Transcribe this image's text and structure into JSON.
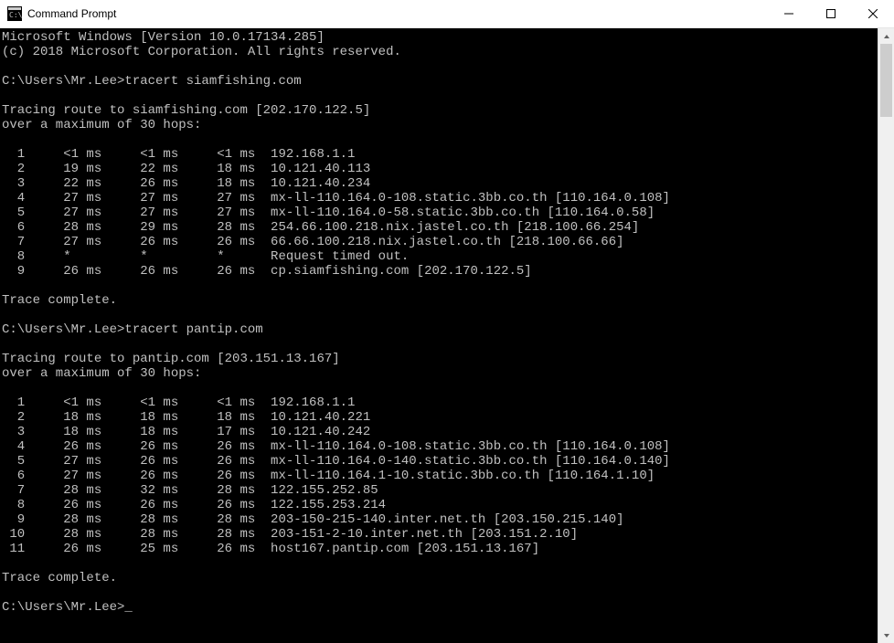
{
  "window": {
    "title": "Command Prompt",
    "minimize_glyph": "─",
    "maximize_glyph": "☐",
    "close_glyph": "✕"
  },
  "os_banner": {
    "line1": "Microsoft Windows [Version 10.0.17134.285]",
    "line2": "(c) 2018 Microsoft Corporation. All rights reserved."
  },
  "prompt_path": "C:\\Users\\Mr.Lee>",
  "commands": [
    {
      "cmd": "tracert siamfishing.com",
      "tracing_line": "Tracing route to siamfishing.com [202.170.122.5]",
      "max_hops_line": "over a maximum of 30 hops:",
      "hops": [
        {
          "n": "1",
          "t1": "<1 ms",
          "t2": "<1 ms",
          "t3": "<1 ms",
          "dest": "192.168.1.1"
        },
        {
          "n": "2",
          "t1": "19 ms",
          "t2": "22 ms",
          "t3": "18 ms",
          "dest": "10.121.40.113"
        },
        {
          "n": "3",
          "t1": "22 ms",
          "t2": "26 ms",
          "t3": "18 ms",
          "dest": "10.121.40.234"
        },
        {
          "n": "4",
          "t1": "27 ms",
          "t2": "27 ms",
          "t3": "27 ms",
          "dest": "mx-ll-110.164.0-108.static.3bb.co.th [110.164.0.108]"
        },
        {
          "n": "5",
          "t1": "27 ms",
          "t2": "27 ms",
          "t3": "27 ms",
          "dest": "mx-ll-110.164.0-58.static.3bb.co.th [110.164.0.58]"
        },
        {
          "n": "6",
          "t1": "28 ms",
          "t2": "29 ms",
          "t3": "28 ms",
          "dest": "254.66.100.218.nix.jastel.co.th [218.100.66.254]"
        },
        {
          "n": "7",
          "t1": "27 ms",
          "t2": "26 ms",
          "t3": "26 ms",
          "dest": "66.66.100.218.nix.jastel.co.th [218.100.66.66]"
        },
        {
          "n": "8",
          "t1": "*",
          "t2": "*",
          "t3": "*",
          "dest": "Request timed out."
        },
        {
          "n": "9",
          "t1": "26 ms",
          "t2": "26 ms",
          "t3": "26 ms",
          "dest": "cp.siamfishing.com [202.170.122.5]"
        }
      ],
      "complete": "Trace complete."
    },
    {
      "cmd": "tracert pantip.com",
      "tracing_line": "Tracing route to pantip.com [203.151.13.167]",
      "max_hops_line": "over a maximum of 30 hops:",
      "hops": [
        {
          "n": "1",
          "t1": "<1 ms",
          "t2": "<1 ms",
          "t3": "<1 ms",
          "dest": "192.168.1.1"
        },
        {
          "n": "2",
          "t1": "18 ms",
          "t2": "18 ms",
          "t3": "18 ms",
          "dest": "10.121.40.221"
        },
        {
          "n": "3",
          "t1": "18 ms",
          "t2": "18 ms",
          "t3": "17 ms",
          "dest": "10.121.40.242"
        },
        {
          "n": "4",
          "t1": "26 ms",
          "t2": "26 ms",
          "t3": "26 ms",
          "dest": "mx-ll-110.164.0-108.static.3bb.co.th [110.164.0.108]"
        },
        {
          "n": "5",
          "t1": "27 ms",
          "t2": "26 ms",
          "t3": "26 ms",
          "dest": "mx-ll-110.164.0-140.static.3bb.co.th [110.164.0.140]"
        },
        {
          "n": "6",
          "t1": "27 ms",
          "t2": "26 ms",
          "t3": "26 ms",
          "dest": "mx-ll-110.164.1-10.static.3bb.co.th [110.164.1.10]"
        },
        {
          "n": "7",
          "t1": "28 ms",
          "t2": "32 ms",
          "t3": "28 ms",
          "dest": "122.155.252.85"
        },
        {
          "n": "8",
          "t1": "26 ms",
          "t2": "26 ms",
          "t3": "26 ms",
          "dest": "122.155.253.214"
        },
        {
          "n": "9",
          "t1": "28 ms",
          "t2": "28 ms",
          "t3": "28 ms",
          "dest": "203-150-215-140.inter.net.th [203.150.215.140]"
        },
        {
          "n": "10",
          "t1": "28 ms",
          "t2": "28 ms",
          "t3": "28 ms",
          "dest": "203-151-2-10.inter.net.th [203.151.2.10]"
        },
        {
          "n": "11",
          "t1": "26 ms",
          "t2": "25 ms",
          "t3": "26 ms",
          "dest": "host167.pantip.com [203.151.13.167]"
        }
      ],
      "complete": "Trace complete."
    }
  ],
  "cursor": "_"
}
